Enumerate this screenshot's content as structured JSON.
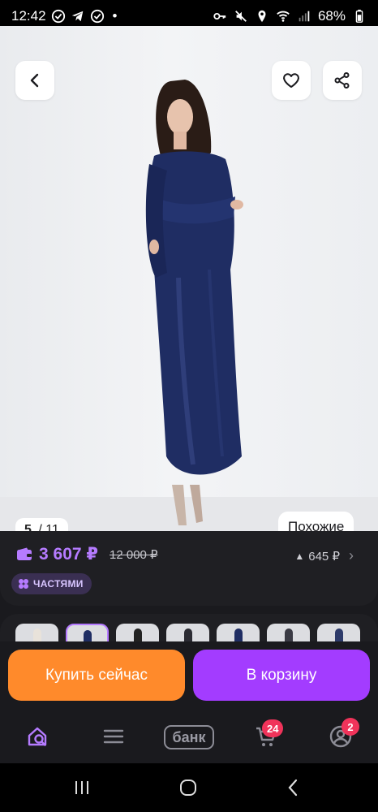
{
  "status_bar": {
    "time": "12:42",
    "battery": "68%",
    "dot": "•"
  },
  "gallery": {
    "current": "5",
    "separator": " / ",
    "total": "11",
    "similar_label": "Похожие"
  },
  "price": {
    "current": "3 607 ₽",
    "old": "12 000 ₽",
    "bonus": "645 ₽",
    "bonus_arrow": "▲",
    "parts_label": "ЧАСТЯМИ"
  },
  "actions": {
    "buy_now": "Купить сейчас",
    "add_to_cart": "В корзину"
  },
  "bottom_nav": {
    "bank_label": "банк",
    "cart_badge": "24",
    "profile_badge": "2"
  },
  "colors": {
    "accent_purple": "#a33cff",
    "price_purple": "#b57bff",
    "buy_orange": "#ff8a2b",
    "badge_red": "#f0335a",
    "dress_navy": "#1f2d63"
  }
}
